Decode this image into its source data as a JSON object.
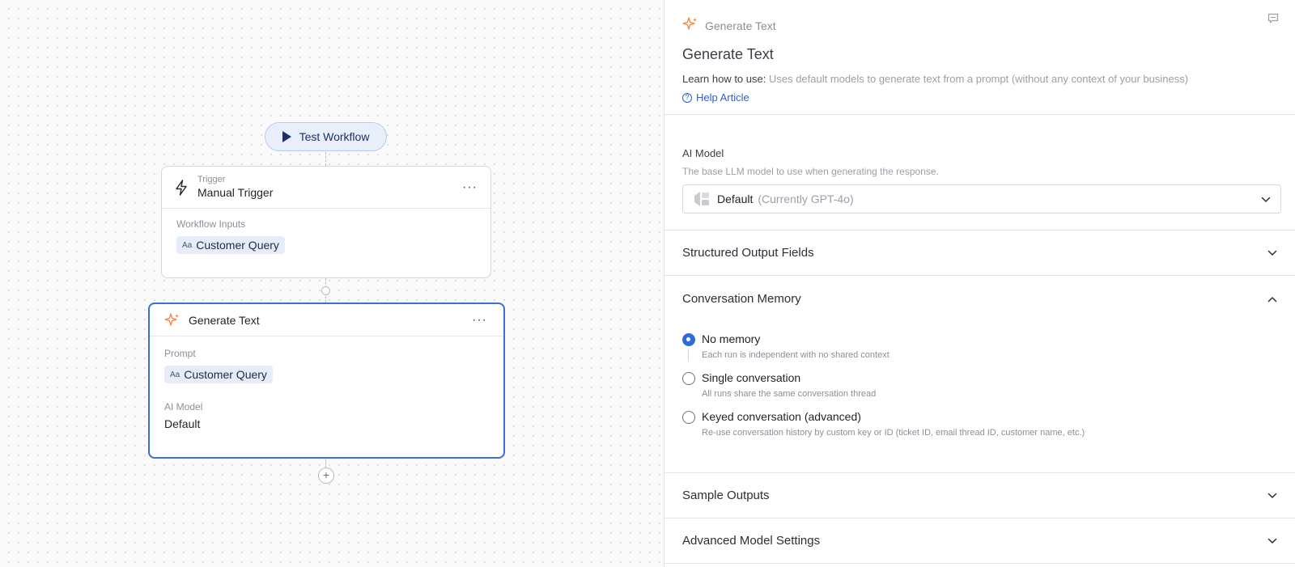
{
  "canvas": {
    "test_button": "Test Workflow",
    "trigger_node": {
      "kicker": "Trigger",
      "name": "Manual Trigger",
      "menu": "···",
      "inputs_label": "Workflow Inputs",
      "input_chip": "Customer Query",
      "chip_icon": "Aa"
    },
    "generate_node": {
      "name": "Generate Text",
      "menu": "···",
      "prompt_label": "Prompt",
      "prompt_chip": "Customer Query",
      "chip_icon": "Aa",
      "model_label": "AI Model",
      "model_value": "Default"
    },
    "add_step": "+"
  },
  "panel": {
    "kicker": "Generate Text",
    "title": "Generate Text",
    "learn_prefix": "Learn how to use:",
    "learn_text": " Uses default models to generate text from a prompt (without any context of your business)",
    "help_link": "Help Article",
    "ai_model": {
      "label": "AI Model",
      "help": "The base LLM model to use when generating the response.",
      "selected": "Default",
      "selected_detail": "(Currently GPT-4o)"
    },
    "sections": {
      "structured": "Structured Output Fields",
      "memory": "Conversation Memory",
      "samples": "Sample Outputs",
      "advanced": "Advanced Model Settings"
    },
    "memory_options": [
      {
        "label": "No memory",
        "desc": "Each run is independent with no shared context",
        "selected": true
      },
      {
        "label": "Single conversation",
        "desc": "All runs share the same conversation thread",
        "selected": false
      },
      {
        "label": "Keyed conversation (advanced)",
        "desc": "Re-use conversation history by custom key or ID (ticket ID, email thread ID, customer name, etc.)",
        "selected": false
      }
    ]
  },
  "colors": {
    "accent": "#2f6bdb",
    "node_selected_border": "#3b6fd4",
    "sparkle": "#f08a4b"
  },
  "icons": [
    "play-icon",
    "lightning-icon",
    "sparkle-icon",
    "more-icon",
    "plus-icon",
    "help-circle-icon",
    "feedback-icon",
    "model-icon",
    "chevron-down-icon",
    "chevron-up-icon"
  ]
}
